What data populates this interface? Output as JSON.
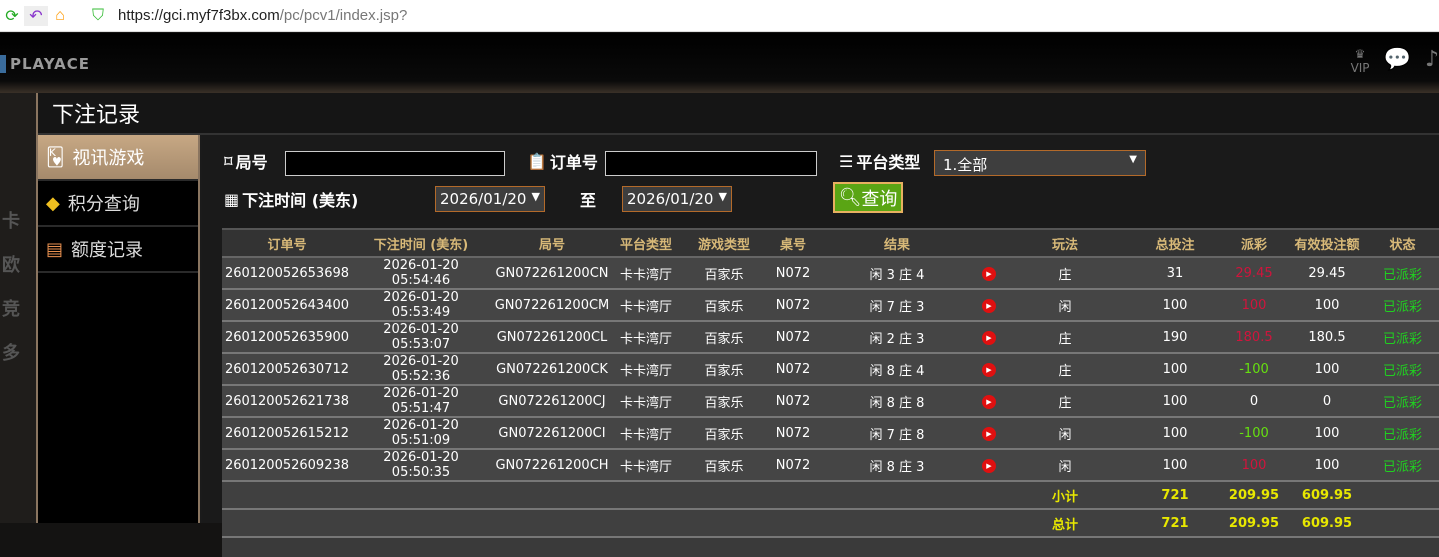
{
  "browser": {
    "url_host": "https://gci.myf7f3bx.com",
    "url_path": "/pc/pcv1/index.jsp?"
  },
  "app": {
    "logo": "PLAYACE",
    "vip": "VIP"
  },
  "background_left": [
    "卡",
    "欧",
    "竞",
    "多"
  ],
  "modal": {
    "title": "下注记录"
  },
  "sidebar": {
    "items": [
      {
        "label": "视讯游戏",
        "icon": "cards-icon",
        "active": true
      },
      {
        "label": "积分查询",
        "icon": "diamond-icon"
      },
      {
        "label": "额度记录",
        "icon": "document-icon"
      }
    ]
  },
  "filters": {
    "round_label": "局号",
    "round_value": "",
    "order_label": "订单号",
    "order_value": "",
    "platform_label": "平台类型",
    "platform_value": "1.全部",
    "time_label": "下注时间 (美东)",
    "date_from": "2026/01/20",
    "to_label": "至",
    "date_to": "2026/01/20",
    "query_label": "查询"
  },
  "colors": {
    "accent": "#5aa514",
    "header_text": "#d8b978",
    "loss": "#d0143c",
    "win": "#66e010",
    "status": "#20d020",
    "summary": "#e8e800"
  },
  "table": {
    "headers": [
      "订单号",
      "下注时间 (美东)",
      "局号",
      "平台类型",
      "游戏类型",
      "桌号",
      "结果",
      "",
      "玩法",
      "总投注",
      "派彩",
      "有效投注额",
      "状态"
    ],
    "rows": [
      [
        "260120052653698",
        "2026-01-20 05:54:46",
        "GN072261200CN",
        "卡卡湾厅",
        "百家乐",
        "N072",
        "闲 3 庄 4",
        "庄",
        "31",
        "29.45",
        "29.45",
        "已派彩",
        "red"
      ],
      [
        "260120052643400",
        "2026-01-20 05:53:49",
        "GN072261200CM",
        "卡卡湾厅",
        "百家乐",
        "N072",
        "闲 7 庄 3",
        "闲",
        "100",
        "100",
        "100",
        "已派彩",
        "red"
      ],
      [
        "260120052635900",
        "2026-01-20 05:53:07",
        "GN072261200CL",
        "卡卡湾厅",
        "百家乐",
        "N072",
        "闲 2 庄 3",
        "庄",
        "190",
        "180.5",
        "180.5",
        "已派彩",
        "red"
      ],
      [
        "260120052630712",
        "2026-01-20 05:52:36",
        "GN072261200CK",
        "卡卡湾厅",
        "百家乐",
        "N072",
        "闲 8 庄 4",
        "庄",
        "100",
        "-100",
        "100",
        "已派彩",
        "grn"
      ],
      [
        "260120052621738",
        "2026-01-20 05:51:47",
        "GN072261200CJ",
        "卡卡湾厅",
        "百家乐",
        "N072",
        "闲 8 庄 8",
        "庄",
        "100",
        "0",
        "0",
        "已派彩",
        ""
      ],
      [
        "260120052615212",
        "2026-01-20 05:51:09",
        "GN072261200CI",
        "卡卡湾厅",
        "百家乐",
        "N072",
        "闲 7 庄 8",
        "闲",
        "100",
        "-100",
        "100",
        "已派彩",
        "grn"
      ],
      [
        "260120052609238",
        "2026-01-20 05:50:35",
        "GN072261200CH",
        "卡卡湾厅",
        "百家乐",
        "N072",
        "闲 8 庄 3",
        "闲",
        "100",
        "100",
        "100",
        "已派彩",
        "red"
      ]
    ],
    "subtotal": {
      "label": "小计",
      "total_bet": "721",
      "payout": "209.95",
      "valid_bet": "609.95"
    },
    "total": {
      "label": "总计",
      "total_bet": "721",
      "payout": "209.95",
      "valid_bet": "609.95"
    }
  }
}
